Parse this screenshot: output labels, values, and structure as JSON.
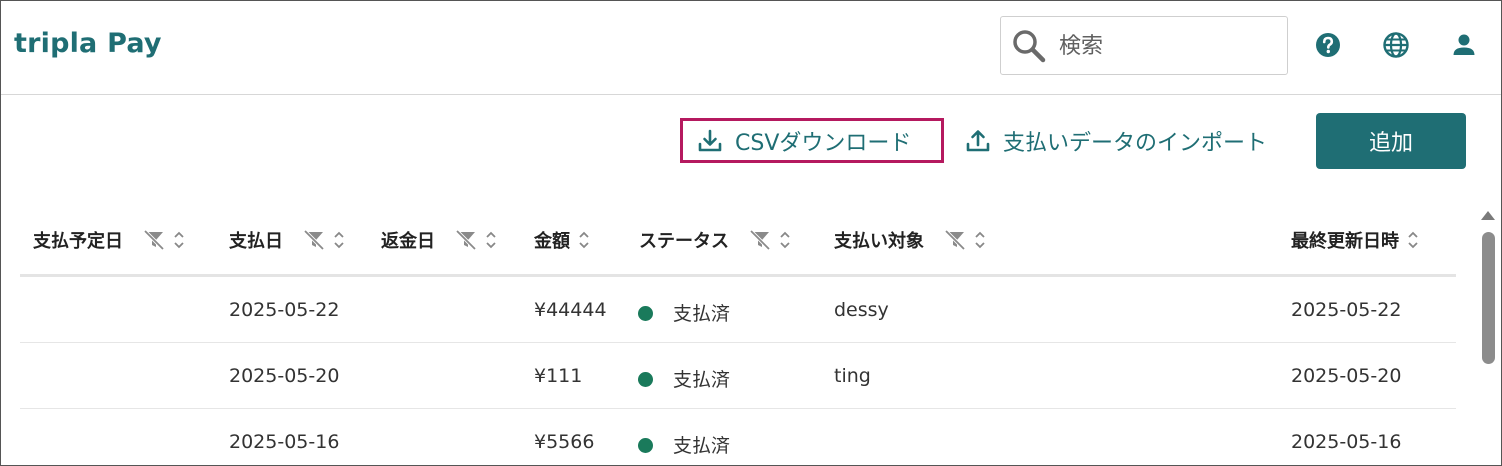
{
  "app": {
    "brand": "tripla Pay"
  },
  "header": {
    "search": {
      "placeholder": "検索"
    },
    "icons": [
      "help-icon",
      "globe-icon",
      "user-icon"
    ]
  },
  "toolbar": {
    "csv_label": "CSVダウンロード",
    "import_label": "支払いデータのインポート",
    "add_label": "追加"
  },
  "table": {
    "columns": [
      "支払予定日",
      "支払日",
      "返金日",
      "金額",
      "ステータス",
      "支払い対象",
      "最終更新日時"
    ],
    "rows": [
      {
        "scheduled": "",
        "paid": "2025-05-22",
        "refund": "",
        "amount": "¥44444",
        "status": "支払済",
        "target": "dessy",
        "updated": "2025-05-22"
      },
      {
        "scheduled": "",
        "paid": "2025-05-20",
        "refund": "",
        "amount": "¥111",
        "status": "支払済",
        "target": "ting",
        "updated": "2025-05-20"
      },
      {
        "scheduled": "",
        "paid": "2025-05-16",
        "refund": "",
        "amount": "¥5566",
        "status": "支払済",
        "target": "",
        "updated": "2025-05-16"
      }
    ]
  },
  "colors": {
    "brand": "#1f6e74",
    "highlight": "#b5195f",
    "status_paid": "#1a7a5b"
  }
}
